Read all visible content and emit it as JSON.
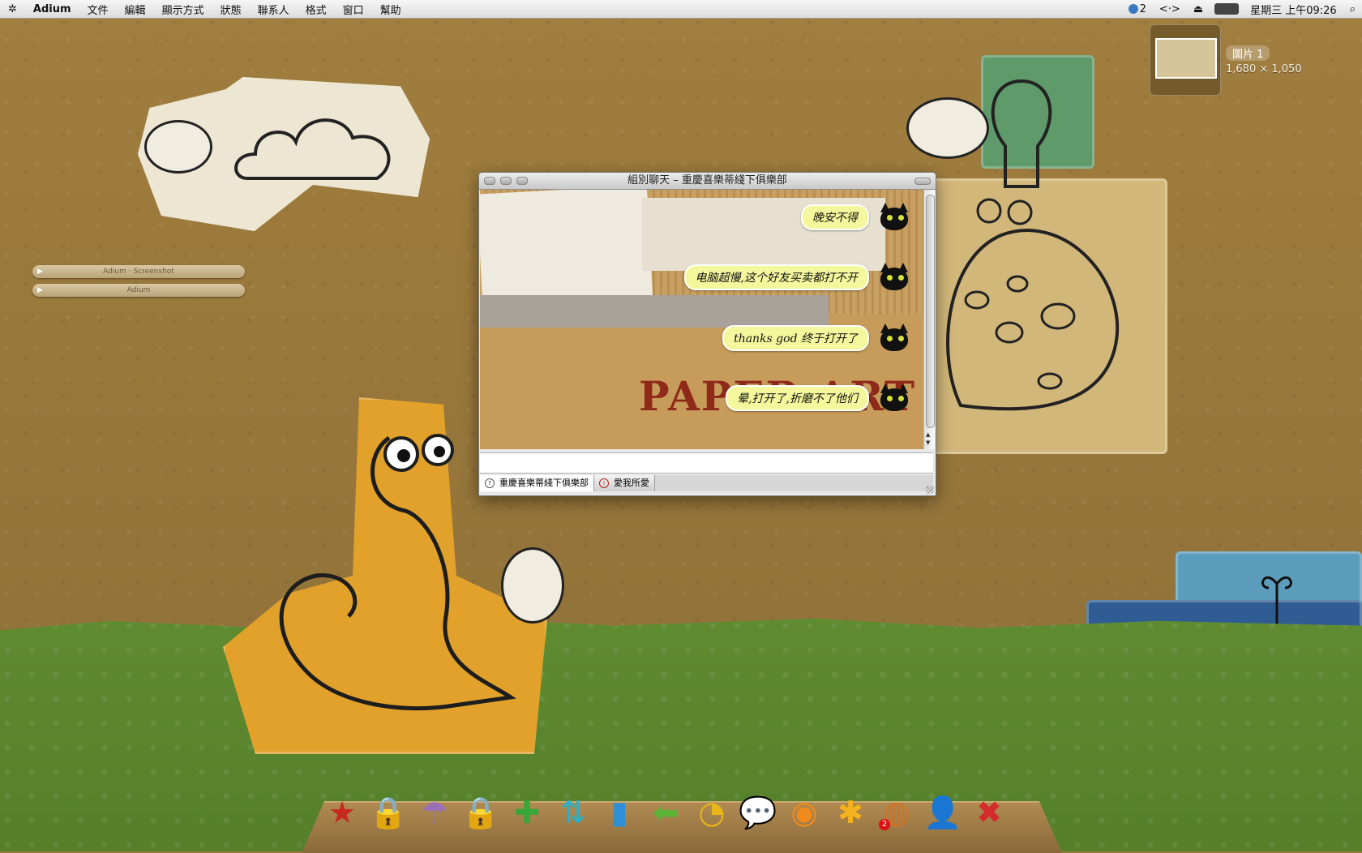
{
  "menubar": {
    "apple": "✲",
    "app": "Adium",
    "items": [
      "文件",
      "編輯",
      "顯示方式",
      "狀態",
      "聯系人",
      "格式",
      "窗口",
      "幫助"
    ],
    "right": {
      "badge": "2",
      "sync": "<·>",
      "eject": "⏏",
      "clock": "星期三 上午09:26",
      "spotlight": "⌕"
    }
  },
  "thumbnail": {
    "title": "圖片 1",
    "size": "1,680 × 1,050"
  },
  "widgets": {
    "bar1": "Adium · Screenshot",
    "bar2": "Adium"
  },
  "chat": {
    "window_title": "組別聊天 – 重慶喜樂蒂綫下俱樂部",
    "background_text": "PAPER ART",
    "messages": [
      {
        "text": "晚安不得"
      },
      {
        "text": "电脑超慢,这个好友买卖都打不开"
      },
      {
        "text": "thanks god 终于打开了"
      },
      {
        "text": "晕,打开了,折磨不了他们"
      }
    ],
    "input_value": "",
    "tabs": [
      {
        "label": "重慶喜樂蒂綫下俱樂部",
        "active": true
      },
      {
        "label": "愛我所愛",
        "active": false
      }
    ]
  },
  "dock": {
    "icons": [
      {
        "name": "star",
        "glyph": "★",
        "color": "#c72a1f"
      },
      {
        "name": "red-lock",
        "glyph": "🔒",
        "color": "#b81d1d"
      },
      {
        "name": "umbrella",
        "glyph": "☂",
        "color": "#9b6fb5"
      },
      {
        "name": "gold-lock",
        "glyph": "🔒",
        "color": "#e6a51c"
      },
      {
        "name": "plus",
        "glyph": "✚",
        "color": "#3aa63a"
      },
      {
        "name": "sync",
        "glyph": "⇅",
        "color": "#2ab0c8"
      },
      {
        "name": "bars",
        "glyph": "▮",
        "color": "#2f8fd6"
      },
      {
        "name": "arrow-left",
        "glyph": "⬅",
        "color": "#5ab335"
      },
      {
        "name": "pie",
        "glyph": "◔",
        "color": "#e8b51a"
      },
      {
        "name": "chat",
        "glyph": "💬",
        "color": "#3c6ed0"
      },
      {
        "name": "rss",
        "glyph": "◉",
        "color": "#f08a1c"
      },
      {
        "name": "asterisk",
        "glyph": "✱",
        "color": "#f2b31e"
      },
      {
        "name": "adium-duck",
        "glyph": "◍",
        "color": "#d17225",
        "badge": "2"
      },
      {
        "name": "user",
        "glyph": "👤",
        "color": "#2f8fd6"
      },
      {
        "name": "close",
        "glyph": "✖",
        "color": "#d32b2b"
      }
    ]
  }
}
